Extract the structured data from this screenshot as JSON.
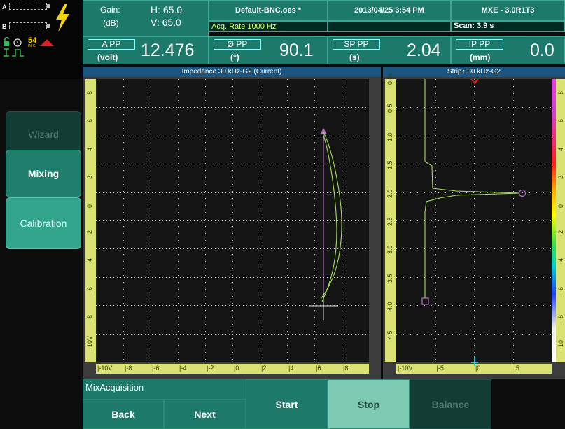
{
  "status": {
    "channel_a": "A",
    "channel_b": "B",
    "temperature": "54",
    "temperature_unit": "IN°C"
  },
  "header": {
    "gain_label": "Gain:",
    "gain_unit": "(dB)",
    "gain_h": "H: 65.0",
    "gain_v": "V: 65.0",
    "file_name": "Default-BNC.oes *",
    "acq_rate": "Acq. Rate 1000  Hz",
    "datetime": "2013/04/25 3:54 PM",
    "version": "MXE - 3.0R1T3",
    "scan": "Scan:  3.9 s"
  },
  "readouts": [
    {
      "label": "A PP",
      "unit": "(volt)",
      "value": "12.476"
    },
    {
      "label": "Ø PP",
      "unit": "(°)",
      "value": "90.1"
    },
    {
      "label": "SP PP",
      "unit": "(s)",
      "value": "2.04"
    },
    {
      "label": "IP PP",
      "unit": "(mm)",
      "value": "0.0"
    }
  ],
  "impedance": {
    "title": "Impedance 30 kHz-G2 (Current)",
    "y_ticks": [
      "8",
      "6",
      "4",
      "2",
      "0",
      "-2",
      "-4",
      "-6",
      "-8",
      "-10V"
    ],
    "x_ticks": [
      "-10V",
      "-8",
      "-6",
      "-4",
      "-2",
      "0",
      "2",
      "4",
      "6",
      "8"
    ]
  },
  "strip": {
    "title": "Strip↑ 30 kHz-G2",
    "time_ticks": [
      "0.0s",
      "0.5",
      "1.0",
      "1.5",
      "2.0",
      "2.5",
      "3.0",
      "3.5",
      "4.0",
      "4.5"
    ],
    "right_ticks": [
      "8",
      "6",
      "4",
      "2",
      "0",
      "-2",
      "-4",
      "-6",
      "-8",
      "-10"
    ],
    "x_ticks": [
      "-10V",
      "-5",
      "0",
      "5"
    ]
  },
  "side_menu": [
    "Wizard",
    "Mixing",
    "Calibration"
  ],
  "bottom": {
    "section_label": "MixAcquisition",
    "back": "Back",
    "next": "Next",
    "start": "Start",
    "stop": "Stop",
    "balance": "Balance"
  },
  "colors": {
    "cell": "#1d7a6a",
    "panel_title": "#1a567f",
    "ruler": "#d9e272",
    "trace": "#a6dc60",
    "cursor": "#b070c0",
    "marker_red": "#e02020"
  }
}
